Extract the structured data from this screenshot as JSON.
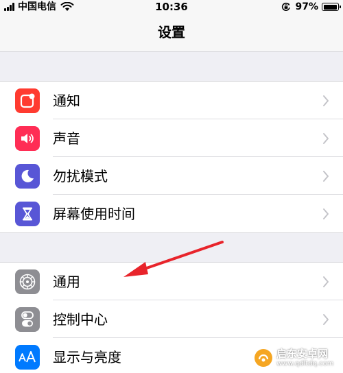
{
  "status_bar": {
    "carrier": "中国电信",
    "time": "10:36",
    "battery_percent": "97%",
    "battery_level": 0.97
  },
  "nav": {
    "title": "设置"
  },
  "groups": [
    {
      "items": [
        {
          "label": "通知",
          "icon": "notification-icon",
          "color": "#ff3b30"
        },
        {
          "label": "声音",
          "icon": "speaker-icon",
          "color": "#ff2d55"
        },
        {
          "label": "勿扰模式",
          "icon": "moon-icon",
          "color": "#5856d6"
        },
        {
          "label": "屏幕使用时间",
          "icon": "hourglass-icon",
          "color": "#5856d6"
        }
      ]
    },
    {
      "items": [
        {
          "label": "通用",
          "icon": "gear-icon",
          "color": "#8e8e93"
        },
        {
          "label": "控制中心",
          "icon": "toggles-icon",
          "color": "#8e8e93"
        },
        {
          "label": "显示与亮度",
          "icon": "text-size-icon",
          "color": "#007aff"
        }
      ]
    }
  ],
  "annotation": {
    "color": "#e8242b"
  },
  "watermark": {
    "name": "启东安卓网",
    "url": "www.qdltdq.com"
  }
}
